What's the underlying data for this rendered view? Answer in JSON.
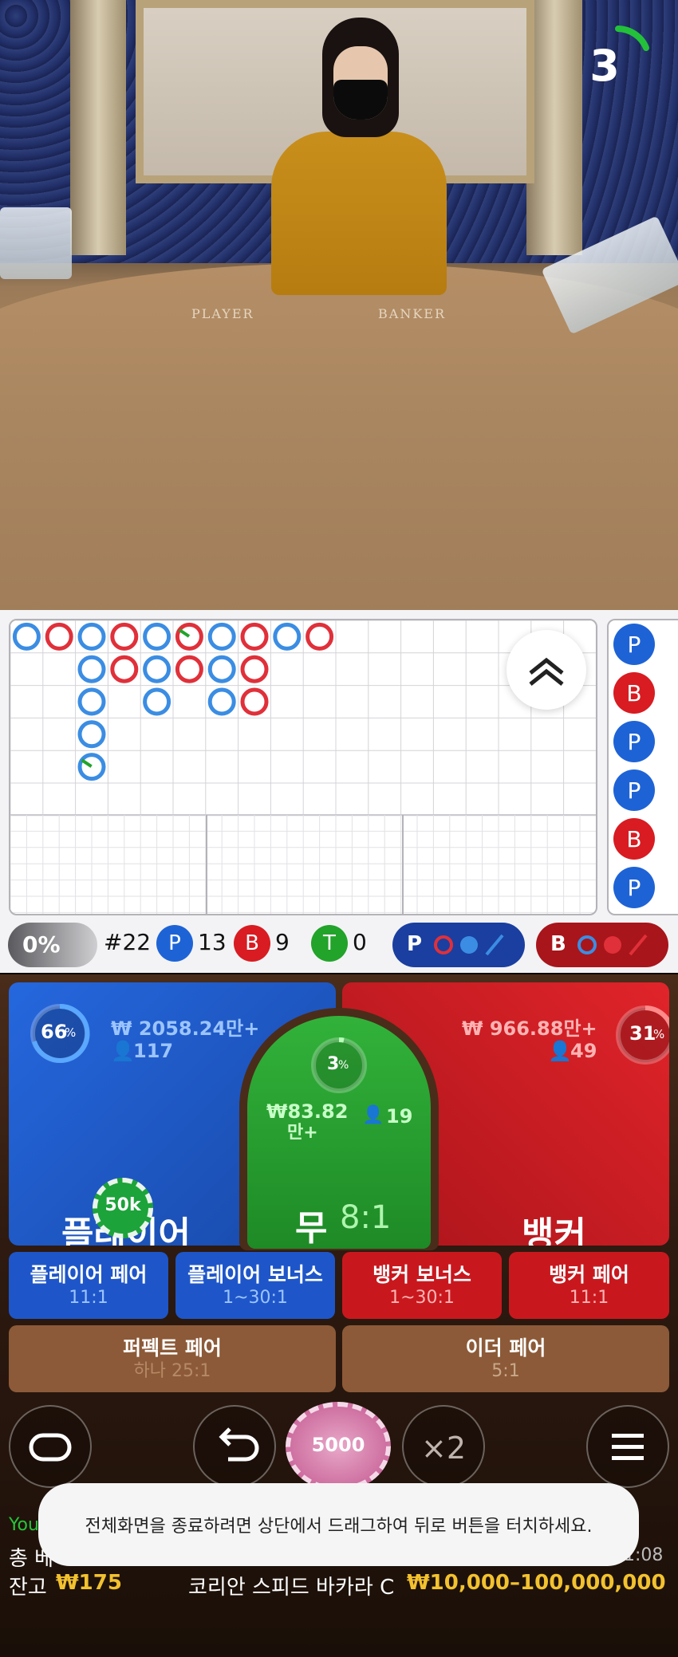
{
  "video": {
    "countdown": "3",
    "player_word": "PLAYER",
    "banker_word": "BANKER"
  },
  "roadmap": {
    "big_road": [
      [
        {
          "c": "P"
        },
        {
          "c": "B"
        },
        {
          "c": "P"
        },
        {
          "c": "B"
        },
        {
          "c": "P"
        },
        {
          "c": "B",
          "tie": true
        },
        {
          "c": "P"
        },
        {
          "c": "B"
        },
        {
          "c": "P"
        },
        {
          "c": "B"
        }
      ],
      [
        null,
        null,
        {
          "c": "P"
        },
        {
          "c": "B"
        },
        {
          "c": "P"
        },
        {
          "c": "B"
        },
        {
          "c": "P"
        },
        {
          "c": "B"
        }
      ],
      [
        null,
        null,
        {
          "c": "P"
        },
        null,
        {
          "c": "P"
        },
        null,
        {
          "c": "P"
        },
        {
          "c": "B"
        }
      ],
      [
        null,
        null,
        {
          "c": "P"
        }
      ],
      [
        null,
        null,
        {
          "c": "P",
          "tie": true
        }
      ]
    ],
    "bead_road": [
      "P",
      "B",
      "P",
      "P",
      "B",
      "P"
    ],
    "toggle_icon": "double-chevron-up-icon"
  },
  "stats": {
    "percent": "0%",
    "round": "#22",
    "player_label": "P",
    "player_count": "13",
    "banker_label": "B",
    "banker_count": "9",
    "tie_label": "T",
    "tie_count": "0",
    "predict_player_label": "P",
    "predict_banker_label": "B"
  },
  "bets": {
    "player": {
      "amount": "₩ 2058.24만+",
      "players": "117",
      "percent": "66",
      "label": "플레이어",
      "chip": "50k"
    },
    "tie": {
      "amount_line1": "₩83.82",
      "amount_line2": "만+",
      "players": "19",
      "percent": "3",
      "label": "무",
      "odds": "8:1"
    },
    "banker": {
      "amount": "₩ 966.88만+",
      "players": "49",
      "percent": "31",
      "label": "뱅커"
    },
    "percent_sign": "%",
    "side": [
      {
        "label": "플레이어 페어",
        "odds": "11:1"
      },
      {
        "label": "플레이어 보너스",
        "odds": "1~30:1"
      },
      {
        "label": "뱅커 보너스",
        "odds": "1~30:1"
      },
      {
        "label": "뱅커 페어",
        "odds": "11:1"
      }
    ],
    "perfect_pair": {
      "label": "퍼펙트 페어",
      "odds": "하나 25:1"
    },
    "either_pair": {
      "label": "이더 페어",
      "odds": "5:1"
    }
  },
  "controls": {
    "chip_value": "5000",
    "double_label": "×2"
  },
  "footer": {
    "you_label": "You",
    "total_label": "총 베",
    "time": "1:08",
    "balance_label": "잔고",
    "balance_value": "₩175",
    "table_name": "코리안 스피드 바카라 C",
    "limits": "₩10,000–100,000,000"
  },
  "toast": {
    "message": "전체화면을 종료하려면 상단에서 드래그하여 뒤로 버튼을 터치하세요."
  },
  "colors": {
    "player": "#1e63d6",
    "banker": "#d81c22",
    "tie": "#22a32a",
    "ring_p": "#3b8de3",
    "ring_b": "#e0303a"
  }
}
